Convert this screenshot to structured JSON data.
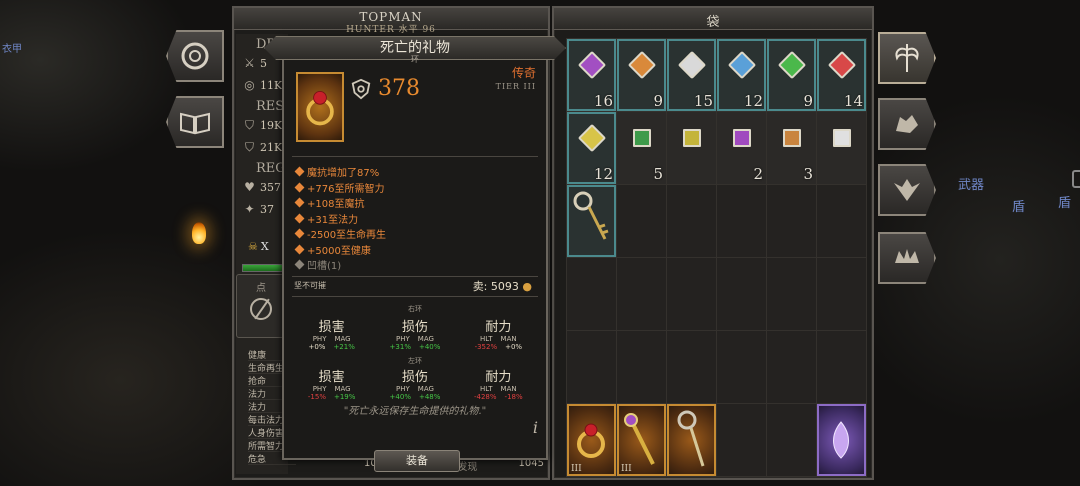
{
  "character": {
    "name": "TOPMAN",
    "class_level": "HUNTER 水平 96",
    "sections": {
      "dps": "DPS",
      "res": "RES",
      "reg": "REG"
    },
    "stats": {
      "dps_a": "5",
      "dps_b": "11K",
      "res_a": "19K",
      "res_b": "21K",
      "reg_a": "357",
      "reg_b": "37"
    },
    "skull_label": "X",
    "points_label": "点",
    "points_value": "0",
    "attribute_list": [
      "健康",
      "生命再生",
      "抢命",
      "法力",
      "法力",
      "每击法力",
      "人身伤害",
      "所需智力",
      "危急"
    ],
    "bottom_values": [
      "10%",
      "神奇的发现",
      "1045"
    ]
  },
  "tooltip": {
    "name": "死亡的礼物",
    "type": "环",
    "power": "378",
    "rarity": "传奇",
    "tier": "TIER III",
    "affixes": [
      "魔抗增加了87%",
      "+776至所需智力",
      "+108至魔抗",
      "+31至法力",
      "-2500至生命再生",
      "+5000至健康"
    ],
    "socket": "凹槽(1)",
    "unbreakable": "坚不可摧",
    "sell_label": "卖: 5093",
    "compare_right_title": "右环",
    "compare_left_title": "左环",
    "compare_headers": [
      "损害",
      "损伤",
      "耐力"
    ],
    "compare_subs": [
      [
        "PHY",
        "MAG"
      ],
      [
        "PHY",
        "MAG"
      ],
      [
        "HLT",
        "MAN"
      ]
    ],
    "compare_right": [
      [
        "+0%",
        "+21%"
      ],
      [
        "+31%",
        "+40%"
      ],
      [
        "-352%",
        "+0%"
      ]
    ],
    "compare_left": [
      [
        "-15%",
        "+19%"
      ],
      [
        "+40%",
        "+48%"
      ],
      [
        "-428%",
        "-18%"
      ]
    ],
    "flavor": "\"死亡永远保存生命提供的礼物.\"",
    "info": "i",
    "equip_button": "装备"
  },
  "bag": {
    "title": "袋",
    "gem_counts": [
      "16",
      "9",
      "15",
      "12",
      "9",
      "14",
      "12",
      "5",
      "",
      "2",
      "3",
      ""
    ],
    "gem_colors": [
      "#a24fc2",
      "#d9893a",
      "#d9d9d9",
      "#5aa0d8",
      "#4bb84b",
      "#d84848",
      "#d8c448",
      "#3e9a4a",
      "#c4b43a",
      "#a04abf",
      "#c9843e",
      "#e0e0e0"
    ],
    "equip_tier": "III"
  },
  "world": {
    "labels": [
      "武器",
      "盾",
      "盾",
      "衣甲"
    ]
  },
  "colors": {
    "legendary": "#e07030",
    "affix": "#e8873a",
    "positive": "#46c446",
    "negative": "#e04040",
    "slot_highlight": "#4b8a8d"
  }
}
